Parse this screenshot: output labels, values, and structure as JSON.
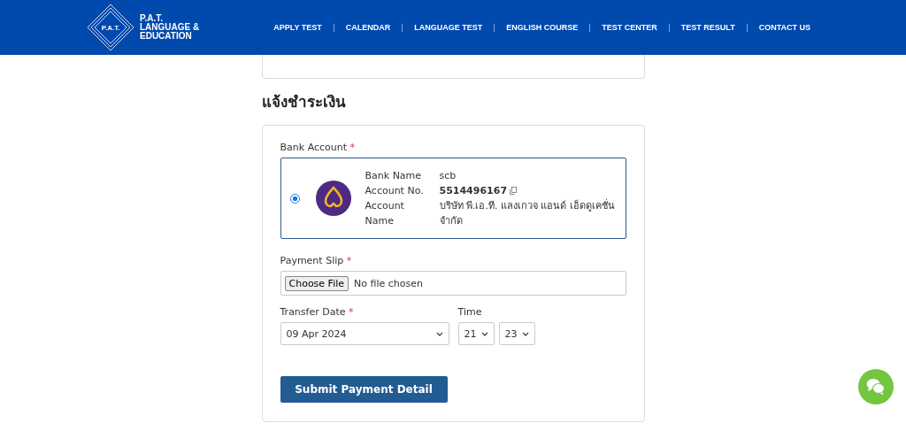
{
  "header": {
    "logo_mark": "P.A.T.",
    "logo_text": [
      "P.A.T.",
      "LANGUAGE &",
      "EDUCATION"
    ],
    "nav": [
      "APPLY TEST",
      "CALENDAR",
      "LANGUAGE TEST",
      "ENGLISH COURSE",
      "TEST CENTER",
      "TEST RESULT",
      "CONTACT US"
    ]
  },
  "section_title": "แจ้งชำระเงิน",
  "form": {
    "bank_label": "Bank Account",
    "bank_required_mark": "*",
    "accounts": [
      {
        "selected": true,
        "fields": [
          {
            "label": "Bank Name",
            "value": "scb",
            "kind": "plain"
          },
          {
            "label": "Account No.",
            "value": "5514496167",
            "kind": "copy"
          },
          {
            "label": "Account Name",
            "value": "บริษัท พี.เอ.ที. แลงเกวจ แอนด์ เอ็ดดูเคชั่น จำกัด",
            "kind": "plain"
          }
        ]
      }
    ],
    "slip_label": "Payment Slip",
    "slip_required_mark": "*",
    "file_button": "Choose File",
    "file_status": "No file chosen",
    "date_label": "Transfer Date",
    "date_required_mark": "*",
    "date_value": "09 Apr 2024",
    "time_label": "Time",
    "hour": "21",
    "minute": "23",
    "submit": "Submit Payment Detail"
  }
}
